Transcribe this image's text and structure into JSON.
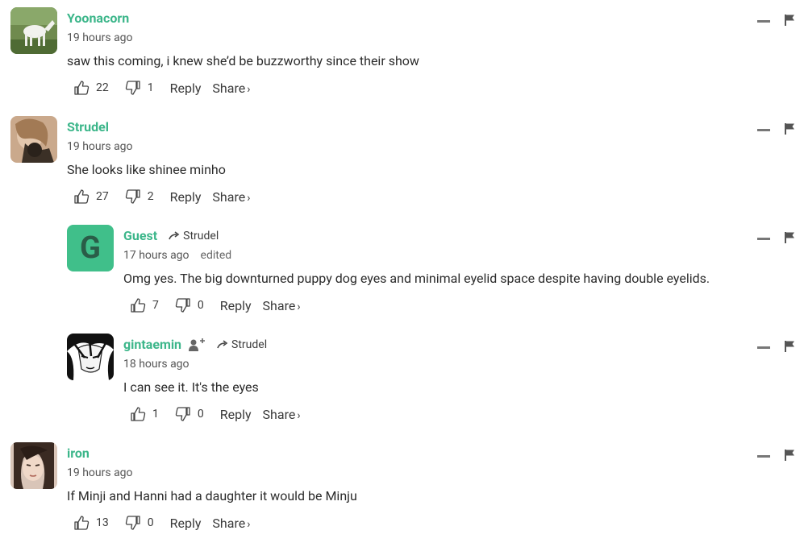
{
  "comments": [
    {
      "author": "Yoonacorn",
      "time": "19 hours ago",
      "edited": "",
      "reply_to": "",
      "text": "saw this coming, i knew she’d be buzzworthy since their show",
      "upvotes": "22",
      "downvotes": "1",
      "reply_label": "Reply",
      "share_label": "Share",
      "avatar": "horse-photo-avatar"
    },
    {
      "author": "Strudel",
      "time": "19 hours ago",
      "edited": "",
      "reply_to": "",
      "text": "She looks like shinee minho",
      "upvotes": "27",
      "downvotes": "2",
      "reply_label": "Reply",
      "share_label": "Share",
      "avatar": "person-photo-avatar"
    },
    {
      "author": "Guest",
      "time": "17 hours ago",
      "edited": "edited",
      "reply_to": "Strudel",
      "text": "Omg yes. The big downturned puppy dog eyes and minimal eyelid space despite having double eyelids.",
      "upvotes": "7",
      "downvotes": "0",
      "reply_label": "Reply",
      "share_label": "Share",
      "avatar_letter": "G"
    },
    {
      "author": "gintaemin",
      "time": "18 hours ago",
      "edited": "",
      "reply_to": "Strudel",
      "text": "I can see it. It's the eyes",
      "upvotes": "1",
      "downvotes": "0",
      "reply_label": "Reply",
      "share_label": "Share",
      "avatar": "manga-character-avatar"
    },
    {
      "author": "iron",
      "time": "19 hours ago",
      "edited": "",
      "reply_to": "",
      "text": "If Minji and Hanni had a daughter it would be Minju",
      "upvotes": "13",
      "downvotes": "0",
      "reply_label": "Reply",
      "share_label": "Share",
      "avatar": "woman-photo-avatar"
    }
  ],
  "colors": {
    "author": "#3cb68a",
    "guest_avatar": "#40bf8a"
  },
  "icons": {
    "like": "thumbs-up-icon",
    "dislike": "thumbs-down-icon",
    "reply_arrow": "reply-arrow-icon",
    "minimize": "minimize-icon",
    "flag": "flag-icon",
    "follow": "follow-user-icon"
  }
}
